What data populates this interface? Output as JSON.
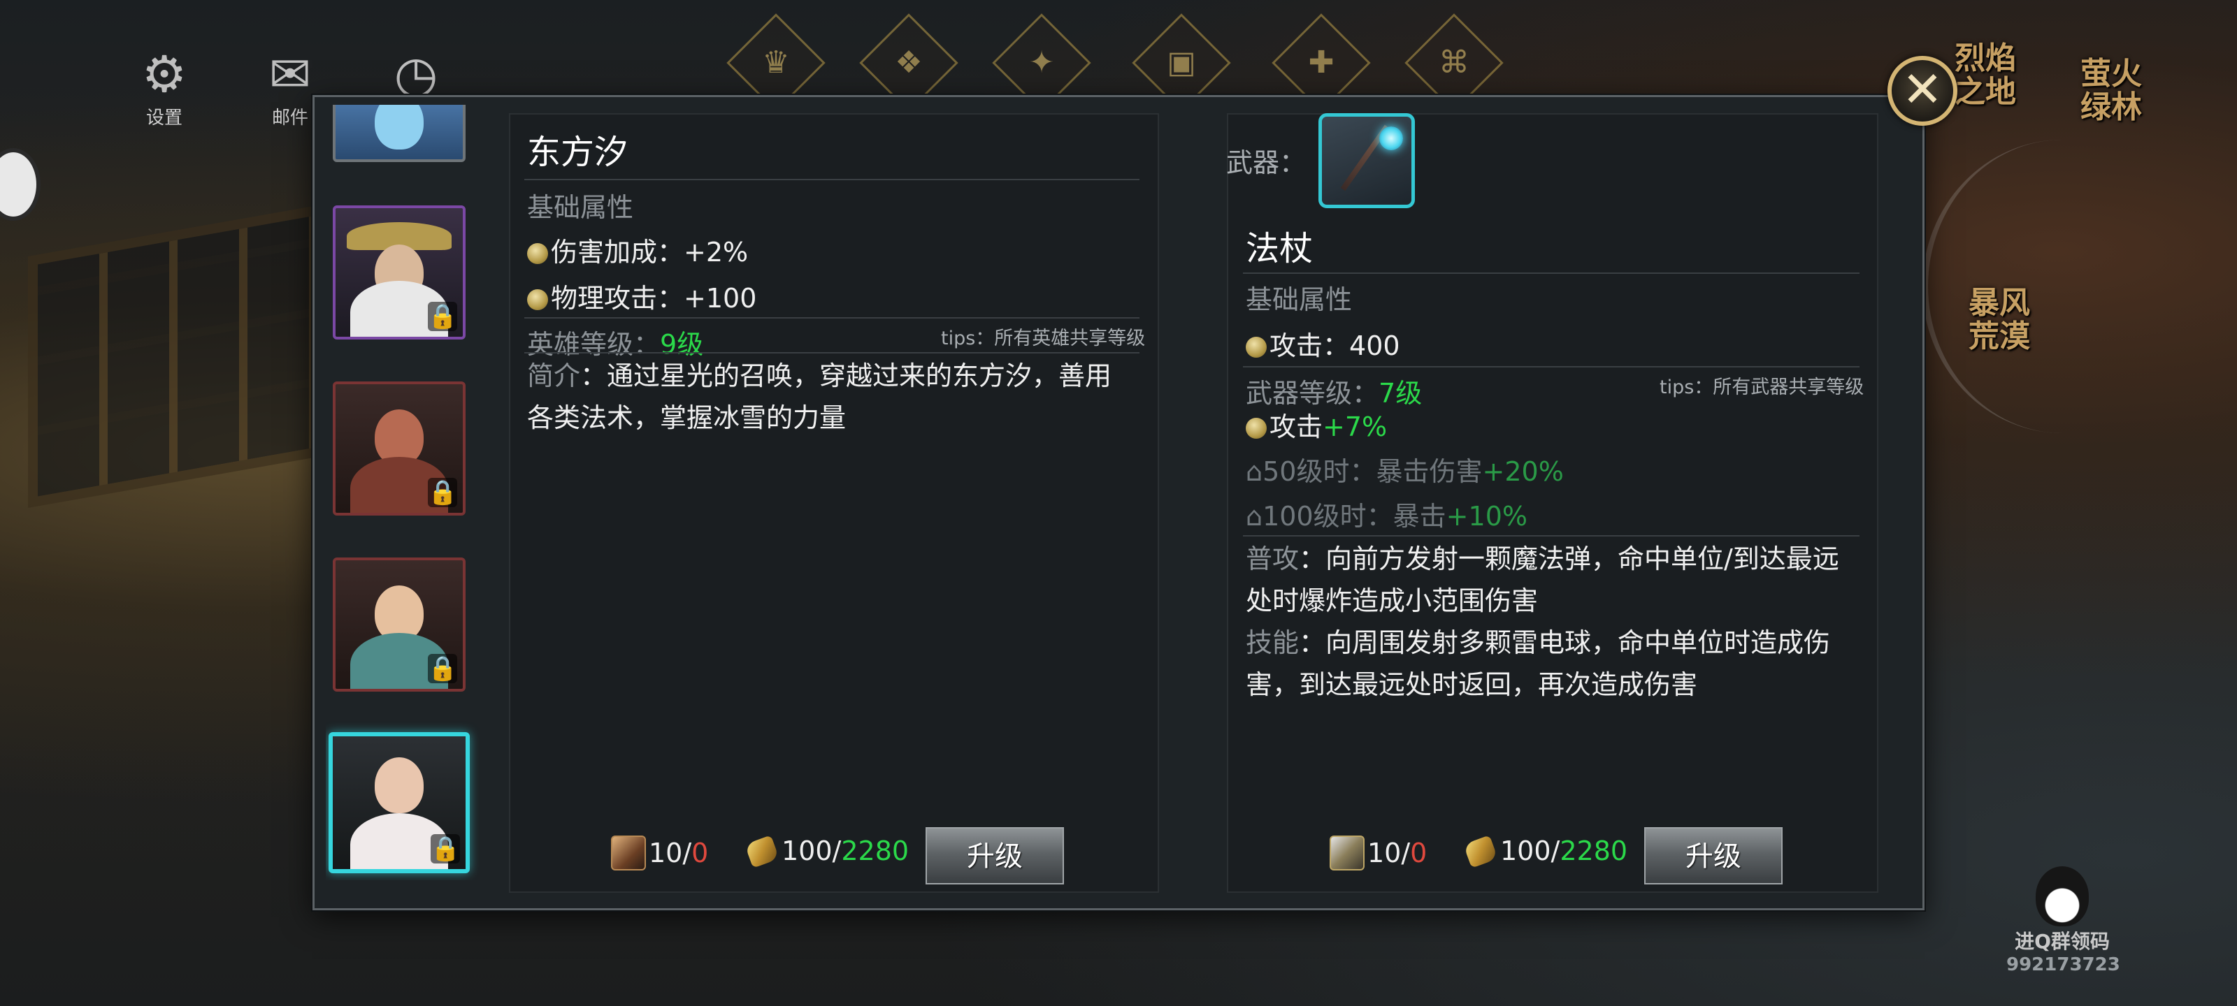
{
  "hud": {
    "settings_label": "设置",
    "mail_label": "邮件"
  },
  "map": {
    "labels": [
      "烈焰之地",
      "萤火绿林",
      "暴风荒漠"
    ]
  },
  "hero_panel": {
    "name": "东方汐",
    "base_attr_title": "基础属性",
    "attrs": [
      {
        "label": "伤害加成：",
        "value": "+2%"
      },
      {
        "label": "物理攻击：",
        "value": "+100"
      }
    ],
    "level_label": "英雄等级：",
    "level_value": "9级",
    "tips": "tips：所有英雄共享等级",
    "intro_label": "简介",
    "intro_text": "：通过星光的召唤，穿越过来的东方汐，善用各类法术，掌握冰雪的力量",
    "cost_shard_have": "10/",
    "cost_shard_need": "0",
    "cost_gold_have": "100/",
    "cost_gold_need": "2280",
    "upgrade_label": "升级"
  },
  "weapon_panel": {
    "slot_label": "武器：",
    "name": "法杖",
    "base_attr_title": "基础属性",
    "attack_label": "攻击：",
    "attack_value": "400",
    "level_label": "武器等级：",
    "level_value": "7级",
    "tips": "tips：所有武器共享等级",
    "bonus_label": "攻击",
    "bonus_value": "+7%",
    "locked": [
      {
        "prefix": "50级时：",
        "label": "暴击伤害",
        "value": "+20%"
      },
      {
        "prefix": "100级时：",
        "label": "暴击",
        "value": "+10%"
      }
    ],
    "normal_label": "普攻",
    "normal_text": "：向前方发射一颗魔法弹，命中单位/到达最远处时爆炸造成小范围伤害",
    "skill_label": "技能",
    "skill_text": "：向周围发射多颗雷电球，命中单位时造成伤害，到达最远处时返回，再次造成伤害",
    "cost_shard_have": "10/",
    "cost_shard_need": "0",
    "cost_gold_have": "100/",
    "cost_gold_need": "2280",
    "upgrade_label": "升级"
  },
  "watermark": {
    "text": "进Q群领码",
    "number": "992173723"
  },
  "colors": {
    "accent_cyan": "#36d6de",
    "green": "#2bd94a",
    "red": "#e0493e",
    "close_gold": "#d4b573"
  },
  "icons": {
    "close": "✕",
    "lock": "🔒",
    "settings": "⚙",
    "mail": "✉",
    "clock": "◷"
  }
}
